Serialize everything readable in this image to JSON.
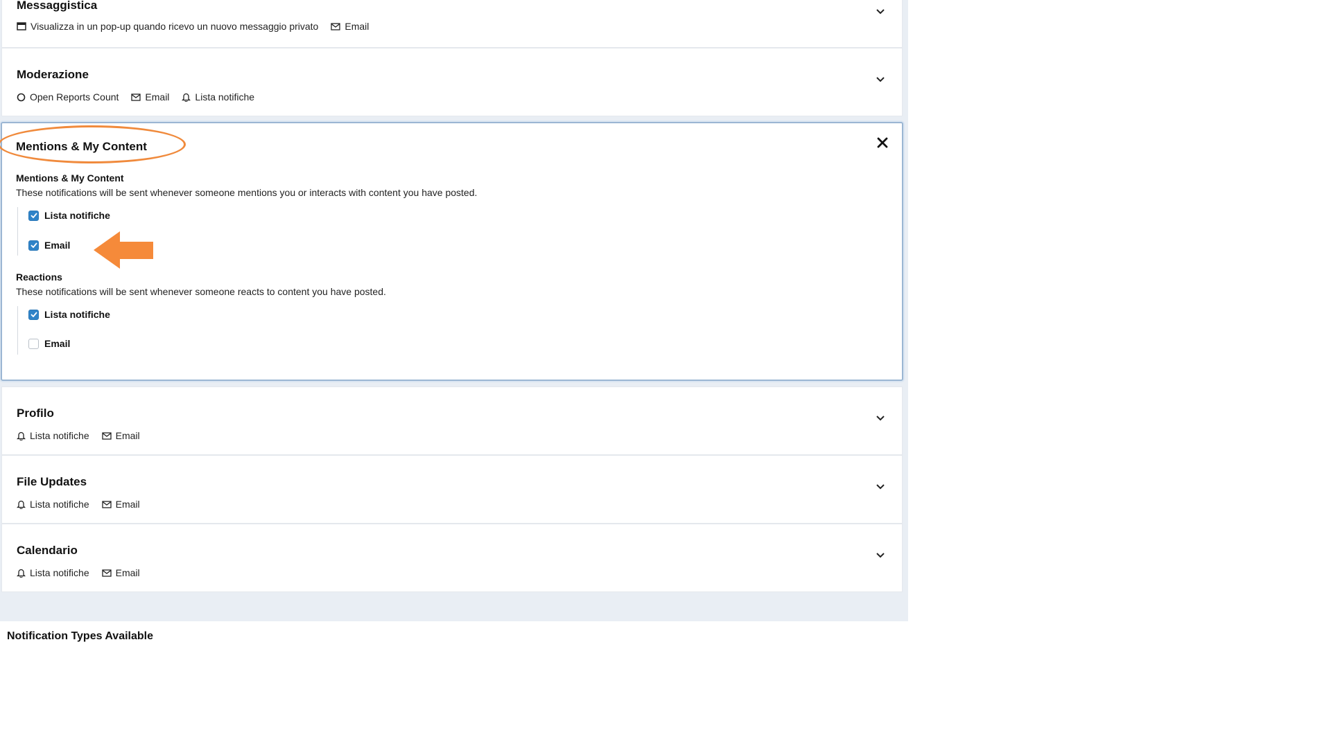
{
  "colors": {
    "accent": "#2f83c8",
    "annotation": "#f08a3c",
    "page_background": "#e9eef4"
  },
  "panels_top": [
    {
      "title": "Messaggistica",
      "meta": [
        {
          "icon": "window-icon",
          "label": "Visualizza in un pop-up quando ricevo un nuovo messaggio privato"
        },
        {
          "icon": "envelope-icon",
          "label": "Email"
        }
      ]
    },
    {
      "title": "Moderazione",
      "meta": [
        {
          "icon": "circle-icon",
          "label": "Open Reports Count"
        },
        {
          "icon": "envelope-icon",
          "label": "Email"
        },
        {
          "icon": "bell-icon",
          "label": "Lista notifiche"
        }
      ]
    }
  ],
  "expanded": {
    "title": "Mentions & My Content",
    "sections": [
      {
        "title": "Mentions & My Content",
        "description": "These notifications will be sent whenever someone mentions you or interacts with content you have posted.",
        "options": [
          {
            "label": "Lista notifiche",
            "checked": true
          },
          {
            "label": "Email",
            "checked": true
          }
        ]
      },
      {
        "title": "Reactions",
        "description": "These notifications will be sent whenever someone reacts to content you have posted.",
        "options": [
          {
            "label": "Lista notifiche",
            "checked": true
          },
          {
            "label": "Email",
            "checked": false
          }
        ]
      }
    ]
  },
  "panels_bottom": [
    {
      "title": "Profilo",
      "meta": [
        {
          "icon": "bell-icon",
          "label": "Lista notifiche"
        },
        {
          "icon": "envelope-icon",
          "label": "Email"
        }
      ]
    },
    {
      "title": "File Updates",
      "meta": [
        {
          "icon": "bell-icon",
          "label": "Lista notifiche"
        },
        {
          "icon": "envelope-icon",
          "label": "Email"
        }
      ]
    },
    {
      "title": "Calendario",
      "meta": [
        {
          "icon": "bell-icon",
          "label": "Lista notifiche"
        },
        {
          "icon": "envelope-icon",
          "label": "Email"
        }
      ]
    }
  ],
  "footer": {
    "heading": "Notification Types Available"
  }
}
